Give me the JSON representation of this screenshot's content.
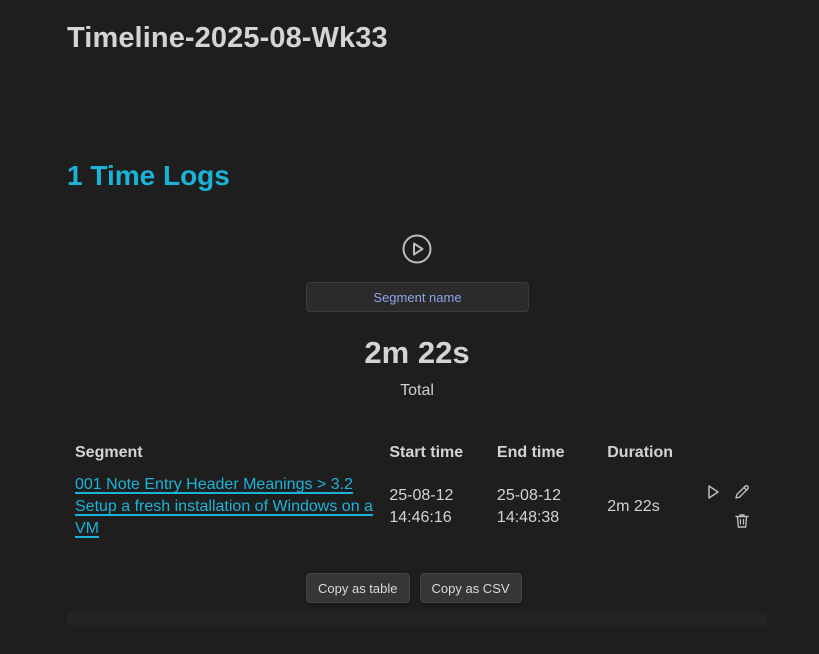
{
  "note": {
    "title": "Timeline-2025-08-Wk33"
  },
  "section": {
    "heading": "1 Time Logs"
  },
  "timer": {
    "segment_placeholder": "Segment name",
    "total_value": "2m 22s",
    "total_label": "Total"
  },
  "table": {
    "headers": [
      "Segment",
      "Start time",
      "End time",
      "Duration"
    ],
    "rows": [
      {
        "segment": "001 Note Entry Header Meanings > 3.2 Setup a fresh installation of Windows on a VM",
        "start_date": "25-08-12",
        "start_time": "14:46:16",
        "end_date": "25-08-12",
        "end_time": "14:48:38",
        "duration": "2m 22s"
      }
    ]
  },
  "buttons": {
    "copy_table": "Copy as table",
    "copy_csv": "Copy as CSV"
  },
  "icons": {
    "start": "play-circle-icon",
    "row_play": "play-icon",
    "row_edit": "pencil-icon",
    "row_delete": "trash-icon"
  },
  "colors": {
    "background": "#1e1e1e",
    "accent": "#1bb3d8",
    "placeholder": "#8da5e8"
  }
}
